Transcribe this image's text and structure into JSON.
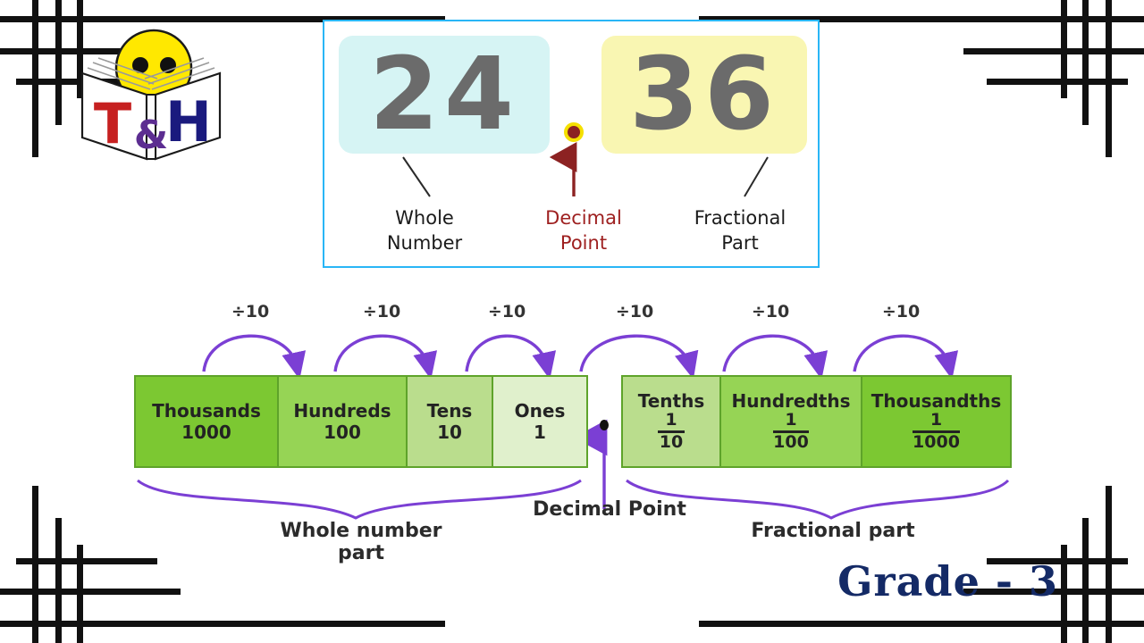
{
  "logo": {
    "name": "th-book-logo",
    "letters": [
      "T",
      "&",
      "H"
    ],
    "colors": {
      "t": "#c62020",
      "amp": "#5c2d91",
      "h": "#1a1a7e",
      "face": "#ffe800"
    }
  },
  "top_card": {
    "whole_digits": "24",
    "fractional_digits": "36",
    "decimal_symbol": ".",
    "labels": {
      "whole": "Whole\nNumber",
      "whole_line1": "Whole",
      "whole_line2": "Number",
      "decimal_line1": "Decimal",
      "decimal_line2": "Point",
      "fraction_line1": "Fractional",
      "fraction_line2": "Part"
    },
    "colors": {
      "whole_box": "#d6f4f4",
      "fraction_box": "#f9f6b2",
      "digit": "#6b6b6b",
      "decimal_dot": "#8c2222",
      "decimal_ring": "#f5e000",
      "decimal_text": "#9e2020",
      "card_border": "#29b6f6"
    }
  },
  "place_value": {
    "whole_columns": [
      {
        "name": "Thousands",
        "value": "1000",
        "shade": "g1"
      },
      {
        "name": "Hundreds",
        "value": "100",
        "shade": "g2"
      },
      {
        "name": "Tens",
        "value": "10",
        "shade": "g3"
      },
      {
        "name": "Ones",
        "value": "1",
        "shade": "g4"
      }
    ],
    "fraction_columns": [
      {
        "name": "Tenths",
        "numerator": "1",
        "denominator": "10",
        "shade": "g3"
      },
      {
        "name": "Hundredths",
        "numerator": "1",
        "denominator": "100",
        "shade": "g2"
      },
      {
        "name": "Thousandths",
        "numerator": "1",
        "denominator": "1000",
        "shade": "g1"
      }
    ],
    "divide_labels": [
      "÷10",
      "÷10",
      "÷10",
      "÷10",
      "÷10",
      "÷10"
    ],
    "decimal_point_symbol": ".",
    "braces": {
      "left": "Whole number part",
      "center": "Decimal Point",
      "right": "Fractional part"
    },
    "colors": {
      "arrow": "#7b3fd4",
      "cell_border": "#5ea32a",
      "dark_green": "#7cc832",
      "mid_green": "#96d455",
      "light_green": "#badd8d",
      "pale_green": "#e0f0cc"
    }
  },
  "grade": {
    "label": "Grade - 3",
    "color": "#142a66"
  },
  "frame": {
    "color": "#111111"
  }
}
